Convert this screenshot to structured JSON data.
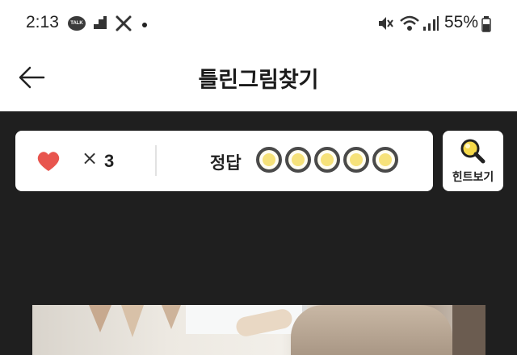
{
  "status_bar": {
    "time": "2:13",
    "talk_badge": "TALK",
    "battery": "55%",
    "icons": [
      "talk-icon",
      "screen-icon",
      "tools-icon",
      "dot-icon",
      "mute-icon",
      "wifi-icon",
      "signal-icon",
      "battery-icon"
    ]
  },
  "header": {
    "title": "틀린그림찾기",
    "back_icon": "arrow-left-icon"
  },
  "game": {
    "lives_prefix": "×",
    "lives": "3",
    "answer_label": "정답",
    "answer_slots_total": 5,
    "answer_slots_found": 0,
    "hint_label": "힌트보기",
    "hint_icon": "magnifier-icon"
  },
  "colors": {
    "background": "#1f1f1f",
    "heart": "#e8554e",
    "slot_fill": "#f6e27a",
    "hint_accent": "#f5d94a"
  }
}
